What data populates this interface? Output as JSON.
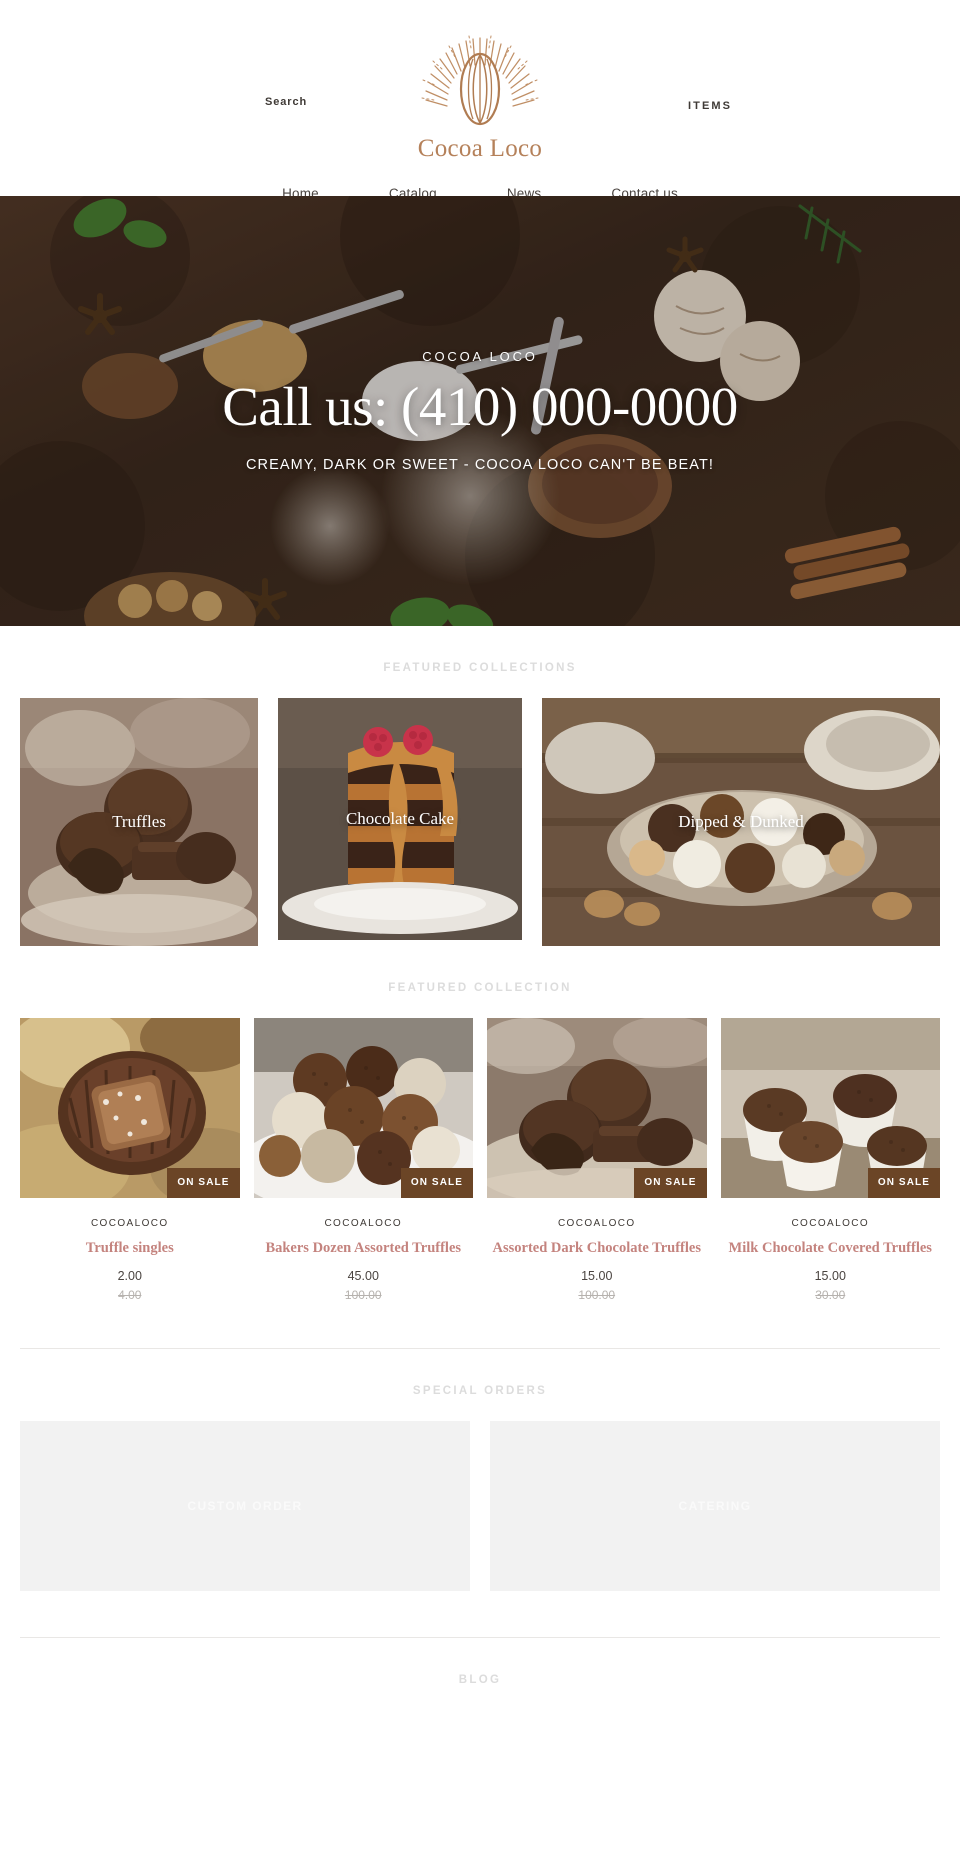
{
  "header": {
    "search_label": "Search",
    "cart_label": "ITEMS",
    "brand_name": "Cocoa Loco",
    "logo_icon": "cocoa-pod-sunburst-icon"
  },
  "nav": {
    "items": [
      {
        "label": "Home"
      },
      {
        "label": "Catalog"
      },
      {
        "label": "News"
      },
      {
        "label": "Contact us"
      }
    ]
  },
  "hero": {
    "kicker": "COCOA LOCO",
    "title": "Call us: (410) 000-0000",
    "subtitle": "CREAMY, DARK OR SWEET - COCOA LOCO CAN'T BE BEAT!"
  },
  "featured_collections": {
    "heading": "FEATURED COLLECTIONS",
    "cards": [
      {
        "label": "Truffles"
      },
      {
        "label": "Chocolate Cake"
      },
      {
        "label": "Dipped & Dunked"
      }
    ]
  },
  "featured_collection": {
    "heading": "FEATURED COLLECTION",
    "sale_badge": "ON SALE",
    "products": [
      {
        "vendor": "COCOALOCO",
        "title": "Truffle singles",
        "price": "2.00",
        "compare_at": "4.00"
      },
      {
        "vendor": "COCOALOCO",
        "title": "Bakers Dozen Assorted Truffles",
        "price": "45.00",
        "compare_at": "100.00"
      },
      {
        "vendor": "COCOALOCO",
        "title": "Assorted Dark Chocolate Truffles",
        "price": "15.00",
        "compare_at": "100.00"
      },
      {
        "vendor": "COCOALOCO",
        "title": "Milk Chocolate Covered Truffles",
        "price": "15.00",
        "compare_at": "30.00"
      }
    ]
  },
  "special_orders": {
    "heading": "SPECIAL ORDERS",
    "cards": [
      {
        "label": "CUSTOM ORDER"
      },
      {
        "label": "CATERING"
      }
    ]
  },
  "blog": {
    "heading": "BLOG"
  },
  "colors": {
    "brand": "#b5815a",
    "product_title": "#c4837e",
    "sale_badge_bg": "#6b4526",
    "section_heading": "#dcdcdc",
    "placeholder_bg": "#f2f2f2"
  }
}
